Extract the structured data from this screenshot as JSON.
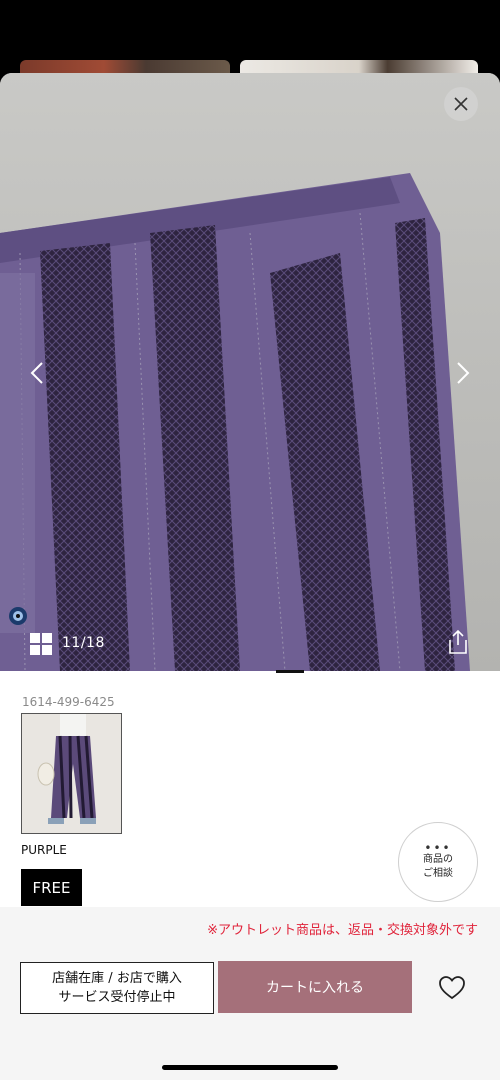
{
  "gallery": {
    "counter": "11/18",
    "close_icon": "close-icon",
    "prev_icon": "chevron-left-icon",
    "next_icon": "chevron-right-icon",
    "grid_icon": "grid-icon",
    "share_icon": "share-icon"
  },
  "product": {
    "sku": "1614-499-6425",
    "color_name": "PURPLE",
    "size": "FREE",
    "colors": {
      "garment": "#6f5f93",
      "stripe": "#2e2440"
    }
  },
  "consult": {
    "label_line1": "商品の",
    "label_line2": "ご相談"
  },
  "bottom": {
    "notice": "※アウトレット商品は、返品・交換対象外です",
    "store_line1": "店舗在庫 / お店で購入",
    "store_line2": "サービス受付停止中",
    "cart_label": "カートに入れる",
    "cart_color": "#a5707a",
    "favorite_icon": "heart-icon"
  }
}
